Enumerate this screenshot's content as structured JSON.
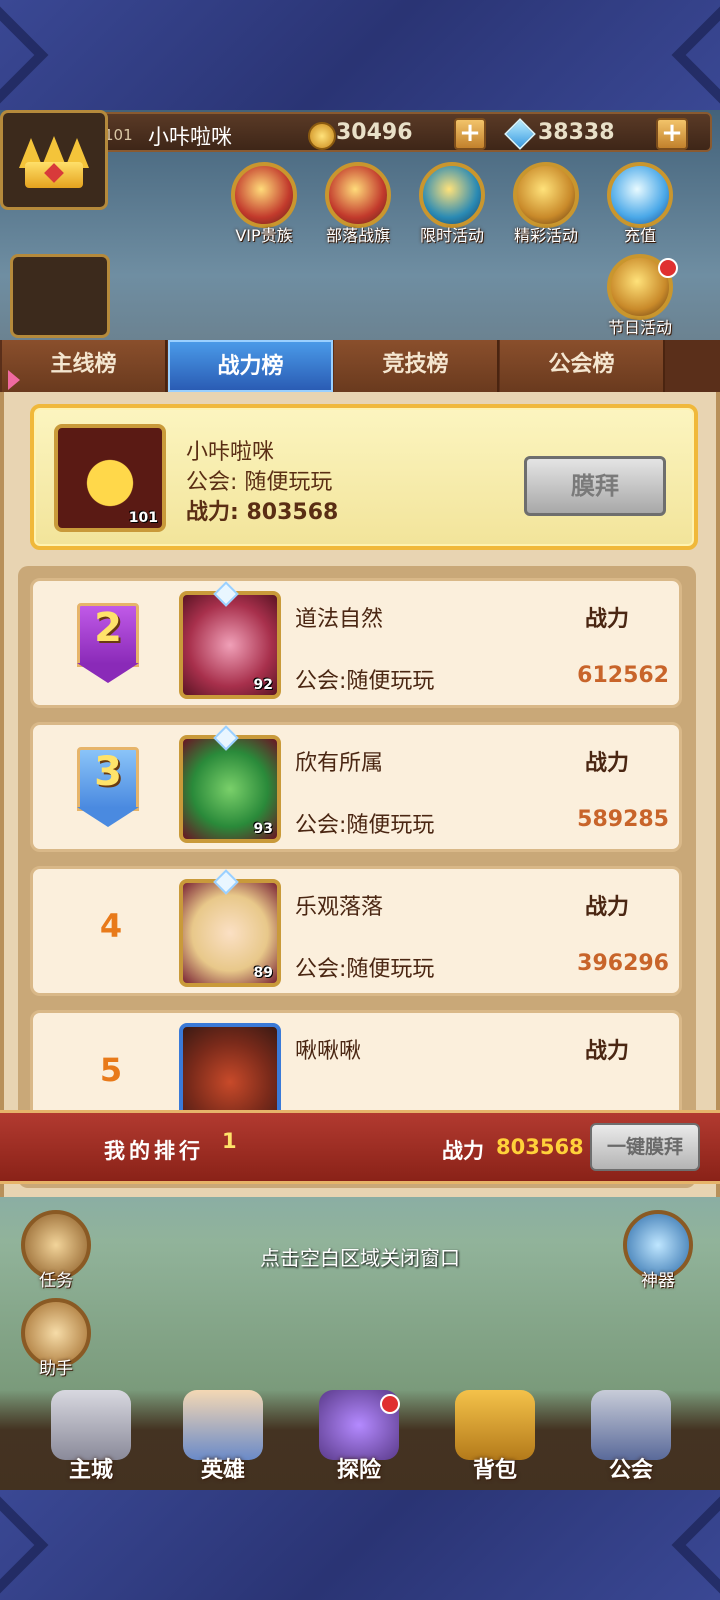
{
  "topbar": {
    "level": "101",
    "player_name": "小咔啦咪",
    "gold": "30496",
    "gems": "38338",
    "plus": "+"
  },
  "activities": [
    {
      "label": "VIP贵族",
      "icon": "vip-crown-icon"
    },
    {
      "label": "部落战旗",
      "icon": "tribe-flag-icon"
    },
    {
      "label": "限时活动",
      "icon": "clock-icon"
    },
    {
      "label": "精彩活动",
      "icon": "chest-icon"
    },
    {
      "label": "充值",
      "icon": "diamond-icon"
    },
    {
      "label": "节日活动",
      "icon": "gift-box-icon"
    }
  ],
  "tabs": [
    {
      "label": "主线榜",
      "active": false
    },
    {
      "label": "战力榜",
      "active": true
    },
    {
      "label": "竞技榜",
      "active": false
    },
    {
      "label": "公会榜",
      "active": false
    }
  ],
  "top_player": {
    "name": "小咔啦咪",
    "guild": "公会: 随便玩玩",
    "power": "战力: 803568",
    "level": "101",
    "worship_label": "膜拜"
  },
  "rankings": [
    {
      "rank": "2",
      "name": "道法自然",
      "guild": "公会:随便玩玩",
      "power_label": "战力",
      "power": "612562",
      "level": "92"
    },
    {
      "rank": "3",
      "name": "欣有所属",
      "guild": "公会:随便玩玩",
      "power_label": "战力",
      "power": "589285",
      "level": "93"
    },
    {
      "rank": "4",
      "name": "乐观落落",
      "guild": "公会:随便玩玩",
      "power_label": "战力",
      "power": "396296",
      "level": "89"
    },
    {
      "rank": "5",
      "name": "啾啾啾",
      "guild": "",
      "power_label": "战力",
      "power": "",
      "level": ""
    }
  ],
  "footer": {
    "my_rank_label": "我的排行",
    "my_rank": "1",
    "power_label": "战力",
    "power": "803568",
    "worship_all_label": "一键膜拜"
  },
  "close_hint": "点击空白区域关闭窗口",
  "side_buttons": {
    "task": "任务",
    "helper": "助手",
    "artifact": "神器"
  },
  "nav": [
    {
      "label": "主城"
    },
    {
      "label": "英雄"
    },
    {
      "label": "探险"
    },
    {
      "label": "背包"
    },
    {
      "label": "公会"
    }
  ],
  "colors": {
    "active_tab": "#2a5cb4",
    "power_value": "#c8642a",
    "rank2_badge": "#a83ad8",
    "rank3_badge": "#5a9ae8",
    "footer_bg": "#b23a30"
  }
}
